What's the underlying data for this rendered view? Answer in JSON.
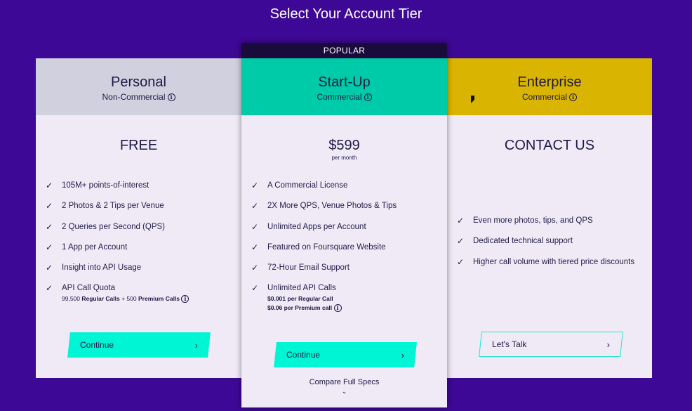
{
  "page": {
    "title": "Select Your Account Tier"
  },
  "colors": {
    "background": "#3d0895",
    "personal_header": "#d0d0df",
    "startup_header": "#00cba8",
    "enterprise_header": "#d9b400",
    "button_accent": "#00f5d4"
  },
  "icons": {
    "check": "check-icon",
    "info": "info-icon",
    "chevron": "chevron-right-icon"
  },
  "personal": {
    "name": "Personal",
    "subtitle": "Non-Commercial",
    "price": "FREE",
    "features": [
      {
        "text": "105M+ points-of-interest"
      },
      {
        "text": "2 Photos & 2 Tips per Venue"
      },
      {
        "text": "2 Queries per Second (QPS)"
      },
      {
        "text": "1 App per Account"
      },
      {
        "text": "Insight into API Usage"
      },
      {
        "text": "API Call Quota"
      }
    ],
    "quota_detail": {
      "regular_count": "99,500",
      "regular_label": "Regular Calls",
      "plus": "+",
      "premium_count": "500",
      "premium_label": "Premium Calls"
    },
    "button": "Continue"
  },
  "startup": {
    "badge": "POPULAR",
    "name": "Start-Up",
    "subtitle": "Commercial",
    "price": "$599",
    "price_period": "per month",
    "features": [
      {
        "text": "A Commercial License"
      },
      {
        "text": "2X More QPS, Venue Photos & Tips"
      },
      {
        "text": "Unlimited Apps per Account"
      },
      {
        "text": "Featured on Foursquare Website"
      },
      {
        "text": "72-Hour Email Support"
      },
      {
        "text": "Unlimited API Calls"
      }
    ],
    "call_pricing": {
      "regular_price": "$0.001",
      "regular_label": "per Regular Call",
      "premium_price": "$0.06",
      "premium_label": "per Premium call"
    },
    "button": "Continue",
    "compare": "Compare Full Specs"
  },
  "enterprise": {
    "name": "Enterprise",
    "subtitle": "Commercial",
    "price": "CONTACT US",
    "features": [
      {
        "text": "Even more photos, tips, and QPS"
      },
      {
        "text": "Dedicated technical support"
      },
      {
        "text": "Higher call volume with tiered price discounts"
      }
    ],
    "button": "Let's Talk"
  }
}
